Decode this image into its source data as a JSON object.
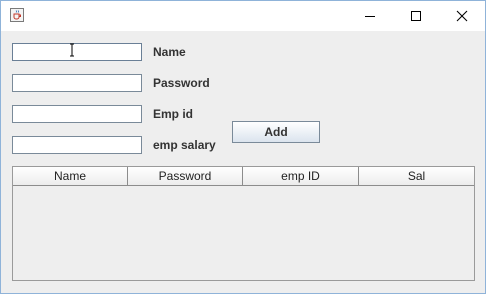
{
  "window": {
    "icon": "java-cup-icon",
    "controls": {
      "minimize": "minimize-icon",
      "maximize": "maximize-icon",
      "close": "close-icon"
    }
  },
  "form": {
    "fields": [
      {
        "label": "Name",
        "value": ""
      },
      {
        "label": "Password",
        "value": ""
      },
      {
        "label": "Emp id",
        "value": ""
      },
      {
        "label": "emp salary",
        "value": ""
      }
    ],
    "add_label": "Add"
  },
  "table": {
    "columns": [
      "Name",
      "Password",
      "emp ID",
      "Sal"
    ],
    "rows": []
  }
}
